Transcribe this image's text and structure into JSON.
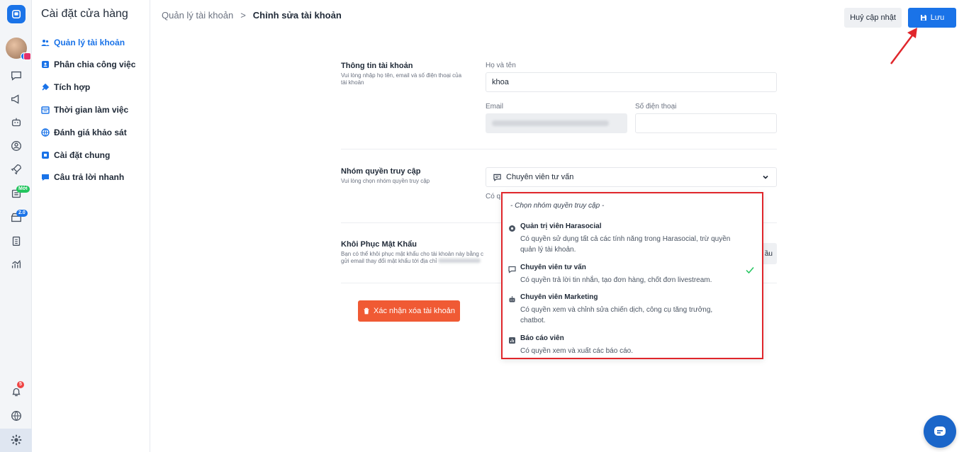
{
  "sidebar": {
    "title": "Cài đặt cửa hàng",
    "items": [
      {
        "label": "Quản lý tài khoản"
      },
      {
        "label": "Phân chia công việc"
      },
      {
        "label": "Tích hợp"
      },
      {
        "label": "Thời gian làm việc"
      },
      {
        "label": "Đánh giá khảo sát"
      },
      {
        "label": "Cài đặt chung"
      },
      {
        "label": "Câu trả lời nhanh"
      }
    ]
  },
  "rail": {
    "badges": {
      "new": "Mới",
      "v2": "2.0",
      "notifications": "5"
    }
  },
  "breadcrumb": {
    "parent": "Quản lý tài khoản",
    "separator": ">",
    "current": "Chỉnh sửa tài khoản"
  },
  "header": {
    "cancel_label": "Huỷ cập nhật",
    "save_label": "Lưu"
  },
  "account_info": {
    "title": "Thông tin tài khoản",
    "desc": "Vui lòng nhập họ tên, email và số điện thoại của tài khoản",
    "name_label": "Họ và tên",
    "name_value": "khoa",
    "email_label": "Email",
    "phone_label": "Số điện thoại",
    "phone_value": ""
  },
  "access_group": {
    "title": "Nhóm quyền truy cập",
    "desc": "Vui lòng chọn nhóm quyền truy cập",
    "selected": "Chuyên viên tư vấn",
    "under_text": "Có q"
  },
  "password_reset": {
    "title": "Khôi Phục Mật Khẩu",
    "desc_line1": "Bạn có thể khôi phục mật khẩu cho tài khoản này bằng c",
    "desc_line2": "gửi email thay đổi mật khẩu tới địa chỉ",
    "button_label_partial": "ầu"
  },
  "delete_button_label": "Xác nhận xóa tài khoản",
  "dropdown": {
    "placeholder": "- Chọn nhóm quyền truy cập -",
    "options": [
      {
        "title": "Quản trị viên Harasocial",
        "desc": "Có quyền sử dụng tất cả các tính năng trong Harasocial, trừ quyền quản lý tài khoản.",
        "icon": "admin-icon"
      },
      {
        "title": "Chuyên viên tư vấn",
        "desc": "Có quyền trả lời tin nhắn, tạo đơn hàng, chốt đơn livestream.",
        "icon": "chat-icon",
        "selected": true
      },
      {
        "title": "Chuyên viên Marketing",
        "desc": "Có quyền xem và chỉnh sửa chiến dịch, công cụ tăng trưởng, chatbot.",
        "icon": "robot-icon"
      },
      {
        "title": "Báo cáo viên",
        "desc": "Có quyền xem và xuất các báo cáo.",
        "icon": "report-icon"
      }
    ]
  },
  "colors": {
    "primary": "#1a73e8",
    "danger": "#f05a34",
    "highlight": "#e0262b",
    "check": "#22c55e"
  }
}
